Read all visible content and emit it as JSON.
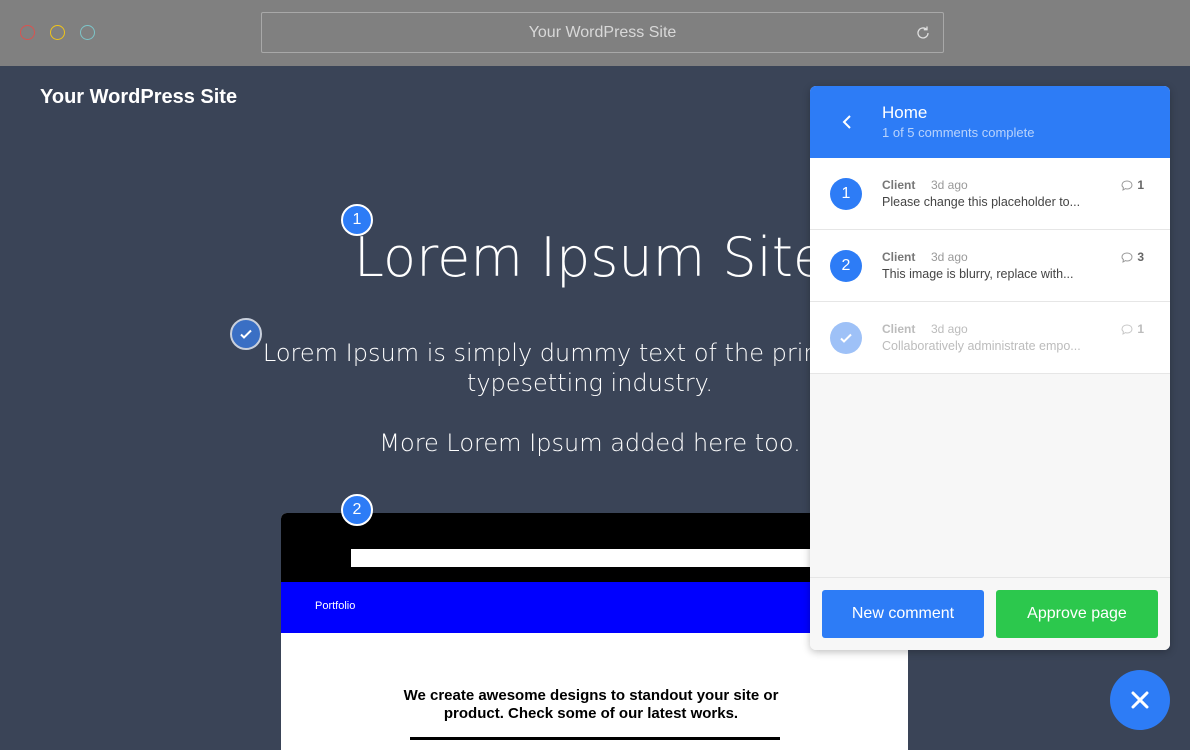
{
  "browser": {
    "url_title": "Your WordPress Site"
  },
  "site": {
    "brand": "Your WordPress Site",
    "hero_title": "Lorem Ipsum Site",
    "hero_text": "Lorem Ipsum is simply dummy text of the printing and typesetting industry.",
    "hero_text2": "More Lorem Ipsum added here too.",
    "preview": {
      "nav_label": "Portfolio",
      "tagline": "We create awesome designs to standout your site or product. Check some of our latest works."
    }
  },
  "pins": [
    {
      "label": "1",
      "state": "open"
    },
    {
      "label": "done",
      "state": "complete",
      "icon": "check-icon"
    },
    {
      "label": "2",
      "state": "open"
    }
  ],
  "panel": {
    "title": "Home",
    "subtitle": "1 of 5 comments complete",
    "comments": [
      {
        "number": "1",
        "author": "Client",
        "time": "3d ago",
        "text": "Please change this placeholder to...",
        "replies": "1",
        "complete": false
      },
      {
        "number": "2",
        "author": "Client",
        "time": "3d ago",
        "text": "This image is blurry, replace with...",
        "replies": "3",
        "complete": false
      },
      {
        "number": "",
        "author": "Client",
        "time": "3d ago",
        "text": "Collaboratively administrate empo...",
        "replies": "1",
        "complete": true
      }
    ],
    "new_comment_label": "New comment",
    "approve_label": "Approve page"
  },
  "colors": {
    "accent": "#2d7cf6",
    "approve": "#2cc84d",
    "background": "#3a4457"
  }
}
